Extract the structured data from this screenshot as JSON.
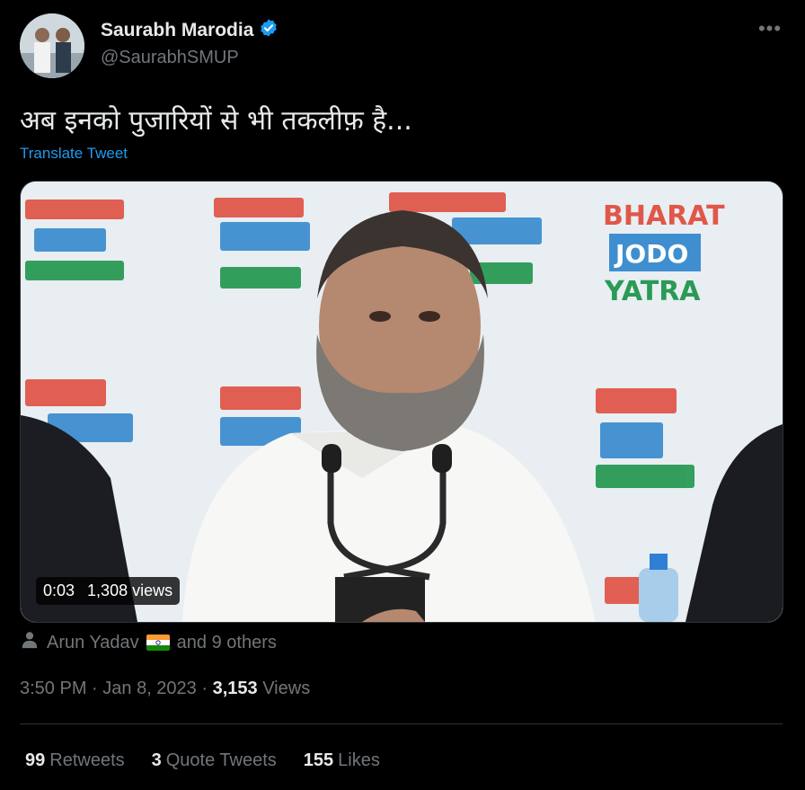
{
  "author": {
    "display_name": "Saurabh Marodia",
    "handle": "@SaurabhSMUP",
    "verified": true,
    "verified_color": "#1d9bf0"
  },
  "more_icon": "ellipsis-icon",
  "tweet": {
    "text": "अब इनको पुजारियों से भी तकलीफ़ है...",
    "translate_label": "Translate Tweet"
  },
  "media": {
    "duration": "0:03",
    "views": "1,308 views",
    "banner_texts": [
      "BHARAT",
      "JODO",
      "YATRA"
    ]
  },
  "tagged": {
    "name": "Arun Yadav",
    "others": "and 9 others"
  },
  "meta": {
    "time": "3:50 PM",
    "separator1": " · ",
    "date": "Jan 8, 2023",
    "separator2": " · ",
    "views_count": "3,153",
    "views_label": "Views"
  },
  "stats": {
    "retweets_count": "99",
    "retweets_label": "Retweets",
    "quotes_count": "3",
    "quotes_label": "Quote Tweets",
    "likes_count": "155",
    "likes_label": "Likes"
  },
  "colors": {
    "background": "#000000",
    "primary_text": "#e7e9ea",
    "secondary_text": "#71767b",
    "link": "#1d9bf0",
    "divider": "#2f3336"
  }
}
